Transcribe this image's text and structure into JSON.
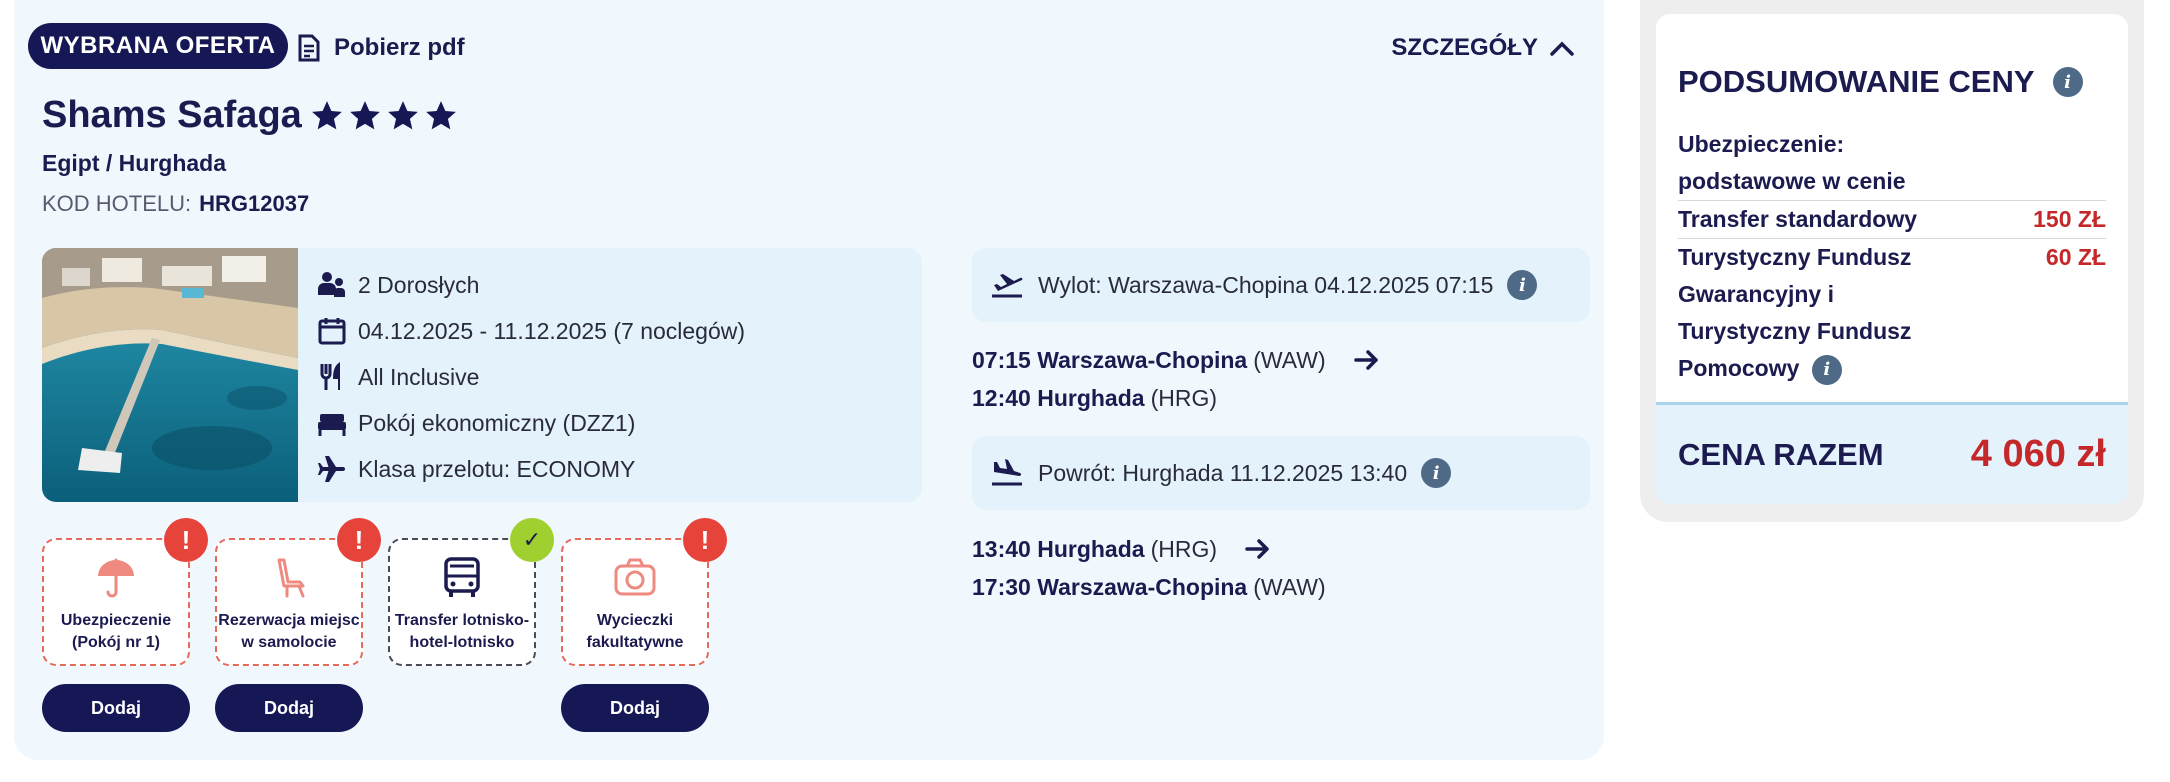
{
  "offer": {
    "badge": "WYBRANA OFERTA",
    "pdf_label": "Pobierz pdf",
    "details_label": "SZCZEGÓŁY",
    "hotel_name": "Shams Safaga",
    "stars": 4,
    "location": "Egipt / Hurghada",
    "hotel_code_label": "KOD HOTELU:",
    "hotel_code": "HRG12037"
  },
  "info": {
    "travelers": "2 Dorosłych",
    "dates": "04.12.2025 - 11.12.2025 (7 noclegów)",
    "board": "All Inclusive",
    "room": "Pokój ekonomiczny (DZZ1)",
    "flight_class": "Klasa przelotu: ECONOMY"
  },
  "services": [
    {
      "label": "Ubezpieczenie\n(Pokój nr 1)",
      "icon": "umbrella-icon",
      "status": "!",
      "button": "Dodaj"
    },
    {
      "label": "Rezerwacja miejsc\nw samolocie",
      "icon": "seat-icon",
      "status": "!",
      "button": "Dodaj"
    },
    {
      "label": "Transfer lotnisko-\nhotel-lotnisko",
      "icon": "bus-icon",
      "status": "✓",
      "button": ""
    },
    {
      "label": "Wycieczki\nfakultatywne",
      "icon": "camera-icon",
      "status": "!",
      "button": "Dodaj"
    }
  ],
  "flights": {
    "outbound": {
      "label": "Wylot: Warszawa-Chopina 04.12.2025 07:15",
      "dep_time": "07:15 Warszawa-Chopina",
      "dep_code": "(WAW)",
      "arr_time": "12:40 Hurghada",
      "arr_code": "(HRG)"
    },
    "return": {
      "label": "Powrót: Hurghada 11.12.2025 13:40",
      "dep_time": "13:40 Hurghada",
      "dep_code": "(HRG)",
      "arr_time": "17:30 Warszawa-Chopina",
      "arr_code": "(WAW)"
    }
  },
  "summary": {
    "title": "PODSUMOWANIE CENY",
    "insurance": "Ubezpieczenie:\npodstawowe w cenie",
    "transfer_label": "Transfer standardowy",
    "transfer_price": "150 ZŁ",
    "fund_label": "Turystyczny Fundusz\nGwarancyjny i\nTurystyczny Fundusz\nPomocowy",
    "fund_price": "60 ZŁ",
    "total_label": "CENA RAZEM",
    "total_price": "4 060 zł"
  },
  "colors": {
    "navy": "#161855",
    "price_red": "#c5282a",
    "warn_red": "#e6443a",
    "check_green": "#9fd02f",
    "panel_blue": "#e3f2fb"
  }
}
